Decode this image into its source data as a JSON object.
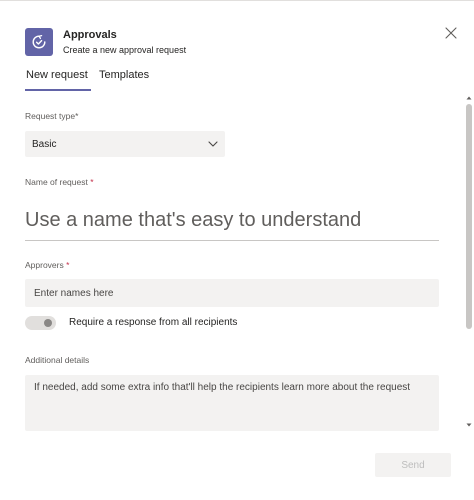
{
  "header": {
    "title": "Approvals",
    "subtitle": "Create a new approval request",
    "icon": "approvals-icon",
    "accent_color": "#6264a7"
  },
  "tabs": [
    {
      "label": "New request",
      "active": true
    },
    {
      "label": "Templates",
      "active": false
    }
  ],
  "form": {
    "request_type": {
      "label": "Request type",
      "required_mark": "*",
      "selected": "Basic"
    },
    "name": {
      "label": "Name of request",
      "required_mark": "*",
      "placeholder": "Use a name that's easy to understand",
      "value": ""
    },
    "approvers": {
      "label": "Approvers",
      "required_mark": "*",
      "placeholder": "Enter names here",
      "value": ""
    },
    "require_all": {
      "label": "Require a response from all recipients",
      "enabled": false
    },
    "details": {
      "label": "Additional details",
      "placeholder": "If needed, add some extra info that'll help the recipients learn more about the request",
      "value": ""
    }
  },
  "footer": {
    "send_label": "Send",
    "send_enabled": false
  }
}
